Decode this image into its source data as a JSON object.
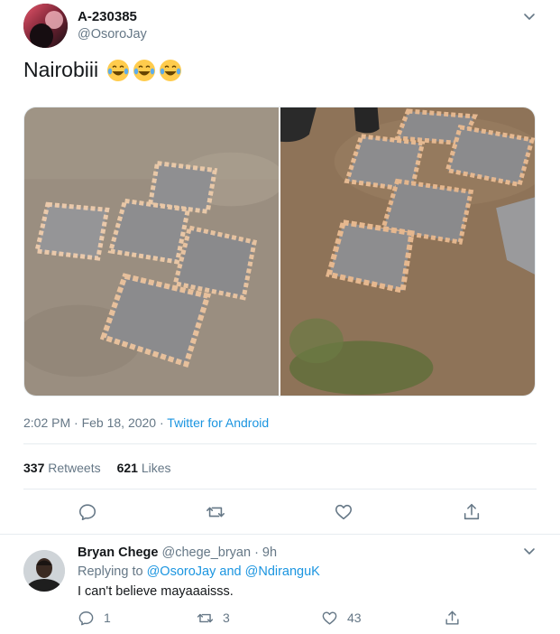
{
  "tweet": {
    "display_name": "A-230385",
    "handle": "@OsoroJay",
    "text": "Nairobiii",
    "emoji": [
      "face-with-tears-of-joy",
      "face-with-tears-of-joy",
      "face-with-tears-of-joy"
    ],
    "timestamp": "2:02 PM · Feb 18, 2020",
    "separator": " · ",
    "source": "Twitter for Android",
    "retweets_count": "337",
    "retweets_label": "Retweets",
    "likes_count": "621",
    "likes_label": "Likes",
    "actions": [
      "reply-icon",
      "retweet-icon",
      "like-icon",
      "share-icon"
    ]
  },
  "reply": {
    "display_name": "Bryan Chege",
    "handle": "@chege_bryan",
    "time": "· 9h",
    "replying_prefix": "Replying to",
    "replying_user1": "@OsoroJay",
    "replying_and": "and",
    "replying_user2": "@NdiranguK",
    "text": "I can't believe mayaaaisss.",
    "reply_count": "1",
    "retweet_count": "3",
    "like_count": "43"
  },
  "colors": {
    "text": "#14171a",
    "secondary": "#657786",
    "link": "#1b95e0",
    "divider": "#e6ecf0"
  }
}
